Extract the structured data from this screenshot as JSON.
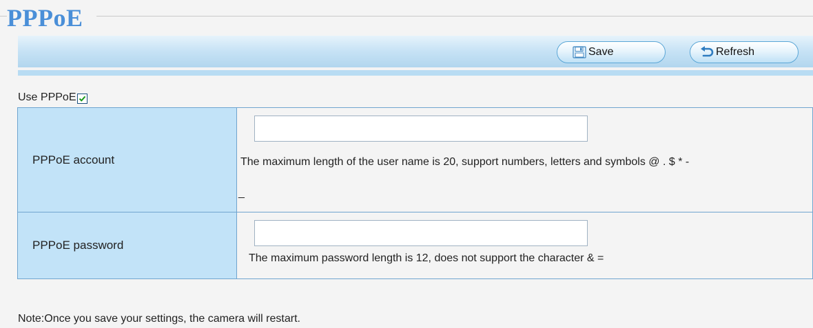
{
  "page": {
    "title": "PPPoE"
  },
  "toolbar": {
    "save_label": "Save",
    "refresh_label": "Refresh",
    "save_icon": "floppy-disk-icon",
    "refresh_icon": "undo-arrow-icon"
  },
  "use_pppoe": {
    "label": "Use PPPoE",
    "checked": true
  },
  "form": {
    "account": {
      "label": "PPPoE account",
      "value": "",
      "hint": "The maximum length of the user name is 20, support numbers, letters and symbols @ . $ * -",
      "hint_extra": "_"
    },
    "password": {
      "label": "PPPoE password",
      "value": "",
      "hint": "The maximum password length is 12, does not support the character & ="
    }
  },
  "note": "Note:Once you save your settings, the camera will restart.",
  "colors": {
    "title": "#4a8fd8",
    "toolbar": "#c6e2f5",
    "label_cell": "#c2e3f8",
    "border": "#6fa4cf",
    "checkbox_check": "#1a9a1a"
  }
}
